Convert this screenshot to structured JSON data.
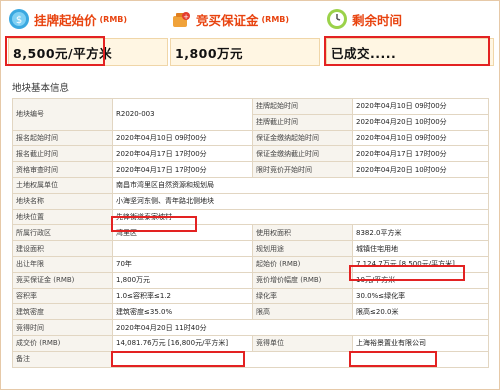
{
  "cards": [
    {
      "title": "挂牌起始价",
      "unit": "(RMB)",
      "value": "8,500元/平方米",
      "icon": "coin-icon"
    },
    {
      "title": "竞买保证金",
      "unit": "(RMB)",
      "value": "1,800万元",
      "icon": "money-bag-icon"
    },
    {
      "title": "剩余时间",
      "unit": "",
      "value": "已成交.....",
      "icon": "clock-icon"
    }
  ],
  "section_title": "地块基本信息",
  "table": {
    "r1_label": "地块编号",
    "r1_value": "R2020-003",
    "r1a_label": "挂牌起始时间",
    "r1a_value": "2020年04月10日 09时00分",
    "r1b_label": "挂牌截止时间",
    "r1b_value": "2020年04月20日 10时00分",
    "r2_label": "报名起始时间",
    "r2_value": "2020年04月10日 09时00分",
    "r2_label2": "保证金缴纳起始时间",
    "r2_value2": "2020年04月10日 09时00分",
    "r3_label": "报名截止时间",
    "r3_value": "2020年04月17日 17时00分",
    "r3_label2": "保证金缴纳截止时间",
    "r3_value2": "2020年04月17日 17时00分",
    "r4_label": "资格审查时间",
    "r4_value": "2020年04月17日 17时00分",
    "r4_label2": "限时竞价开始时间",
    "r4_value2": "2020年04月20日 10时00分",
    "r5_label": "土地权属单位",
    "r5_value": "南昌市湾里区自然资源和规划局",
    "r6_label": "地块名称",
    "r6_value": "小海坚河东侧、青年路北侧地块",
    "r7_label": "地块位置",
    "r7_value": "先锋街道泰家坡村",
    "r8_label": "所属行政区",
    "r8_value": "湾里区",
    "r8_label2": "使用权面积",
    "r8_value2": "8382.0平方米",
    "r9_label": "建设面积",
    "r9_value": "",
    "r9_label2": "规划用途",
    "r9_value2": "城镇住宅用地",
    "r10_label": "出让年限",
    "r10_value": "70年",
    "r10_label2": "起始价 (RMB)",
    "r10_value2": "7,124.7万元 [8,500元/平方米]",
    "r11_label": "竞买保证金 (RMB)",
    "r11_value": "1,800万元",
    "r11_label2": "竞价增价幅度 (RMB)",
    "r11_value2": "10元/平方米",
    "r12_label": "容积率",
    "r12_value": "1.0≤容积率≤1.2",
    "r12_label2": "绿化率",
    "r12_value2": "30.0%≤绿化率",
    "r13_label": "建筑密度",
    "r13_value": "建筑密度≤35.0%",
    "r13_label2": "限高",
    "r13_value2": "限高≤20.0米",
    "r14_label": "竞得时间",
    "r14_value": "2020年04月20日 11时40分",
    "r15_label": "成交价 (RMB)",
    "r15_value": "14,081.76万元 [16,800元/平方米]",
    "r15_label2": "竞得单位",
    "r15_value2": "上海裕景置业有限公司",
    "r16_label": "备注",
    "r16_value": ""
  }
}
